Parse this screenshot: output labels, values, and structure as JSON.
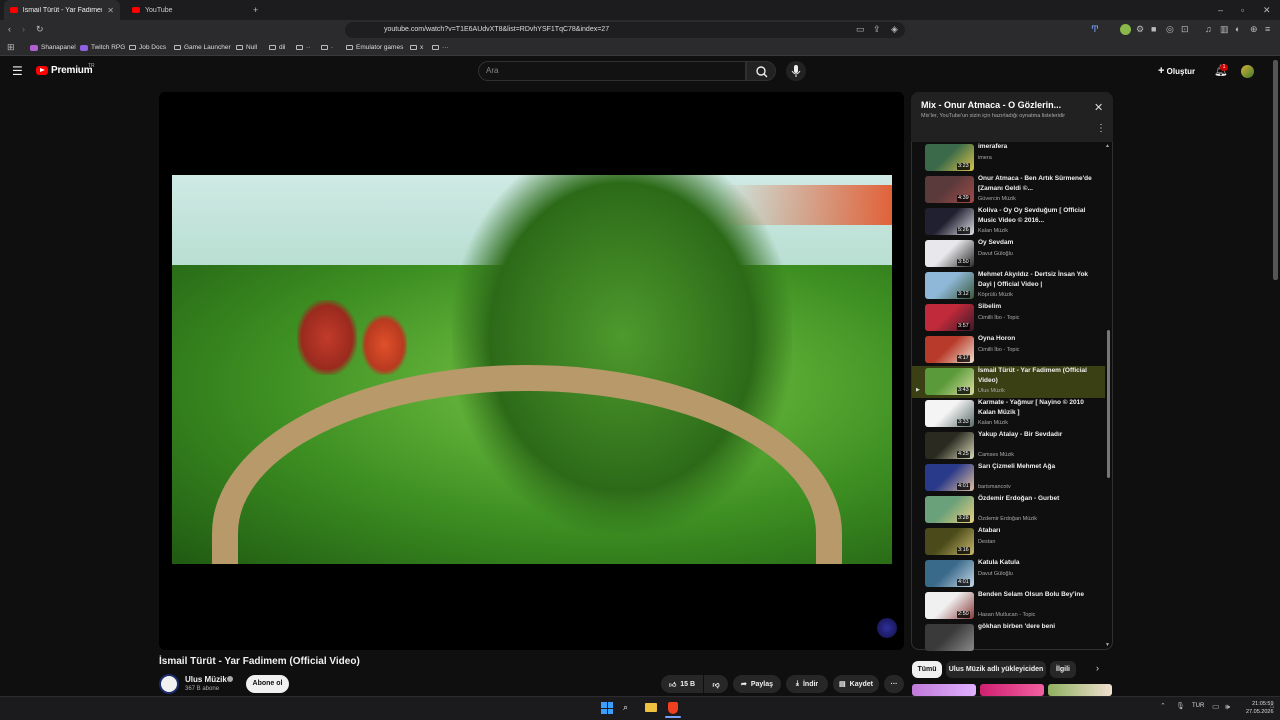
{
  "browser": {
    "tabs": [
      {
        "label": "İsmail Türüt - Yar Fadimem (O"
      },
      {
        "label": "YouTube"
      }
    ],
    "url": "youtube.com/watch?v=T1E6AUdvXT8&list=RDvhYSF1TqC78&index=27",
    "bookmarks": [
      "Shanapanel",
      "Twitch RPG",
      "Job Docs",
      "Game Launcher",
      "Null",
      "dil",
      "Emulator games",
      "x"
    ]
  },
  "youtube": {
    "logo_text": "Premium",
    "logo_region": "TR",
    "search_placeholder": "Ara",
    "create_label": "Oluştur",
    "notif_count": "1"
  },
  "video": {
    "title": "İsmail Türüt - Yar Fadimem (Official Video)",
    "channel": "Ulus Müzik",
    "subscribers": "367 B abone",
    "subscribe_label": "Abone ol",
    "likes": "15 B",
    "share_label": "Paylaş",
    "download_label": "İndir",
    "save_label": "Kaydet"
  },
  "playlist": {
    "title": "Mix - Onur Atmaca - O Gözlerin...",
    "subtitle": "Mix'ler, YouTube'un sizin için hazırladığı oynatma listeleridir",
    "items": [
      {
        "title": "imerafera",
        "channel": "imera",
        "duration": "3:23",
        "c1": "#3a6a4a",
        "c2": "#d9c24a"
      },
      {
        "title": "Onur Atmaca - Ben Artık Sürmene'de [Zamanı Geldi ©...",
        "channel": "Güvercin Müzik",
        "duration": "4:39",
        "c1": "#5a3a3a",
        "c2": "#a04a4a"
      },
      {
        "title": "Koliva - Oy Oy Sevduğum [ Official Music Video © 2016...",
        "channel": "Kalan Müzik",
        "duration": "5:26",
        "c1": "#202030",
        "c2": "#e0e0e8"
      },
      {
        "title": "Oy Sevdam",
        "channel": "Davut Güloğlu",
        "duration": "3:50",
        "c1": "#e8e8ec",
        "c2": "#2a2a2a"
      },
      {
        "title": "Mehmet Akyıldız - Dertsiz İnsan Yok Dayi | Official Video |",
        "channel": "Köprülü Müzik",
        "duration": "3:12",
        "c1": "#8fb8d8",
        "c2": "#3a5a3a"
      },
      {
        "title": "Sibelim",
        "channel": "Cimilli İbo - Topic",
        "duration": "3:57",
        "c1": "#c02a3a",
        "c2": "#3a1a2a"
      },
      {
        "title": "Oyna Horon",
        "channel": "Cimilli İbo - Topic",
        "duration": "4:17",
        "c1": "#b83a2a",
        "c2": "#f0e0d0"
      },
      {
        "title": "İsmail Türüt - Yar Fadimem (Official Video)",
        "channel": "Ulus Müzik",
        "duration": "3:43",
        "c1": "#5a9a3a",
        "c2": "#d8e0a0"
      },
      {
        "title": "Karmate - Yağmur [ Nayino © 2010 Kalan Müzik ]",
        "channel": "Kalan Müzik",
        "duration": "3:33",
        "c1": "#f4f4f4",
        "c2": "#5a6a6a"
      },
      {
        "title": "Yakup Atalay - Bir Sevdadır",
        "channel": "Camses Müzik",
        "duration": "4:25",
        "c1": "#2a2a20",
        "c2": "#d8d8b8"
      },
      {
        "title": "Sarı Çizmeli Mehmet Ağa",
        "channel": "barismancotv",
        "duration": "4:01",
        "c1": "#2a3a8a",
        "c2": "#e0c0a0"
      },
      {
        "title": "Özdemir Erdoğan - Gurbet",
        "channel": "Özdemir Erdoğan Müzik",
        "duration": "3:28",
        "c1": "#6aa07a",
        "c2": "#e8d080"
      },
      {
        "title": "Atabarı",
        "channel": "Destan",
        "duration": "3:16",
        "c1": "#4a4a1a",
        "c2": "#c8b86a"
      },
      {
        "title": "Katula Katula",
        "channel": "Davut Güloğlu",
        "duration": "4:01",
        "c1": "#3a6a8a",
        "c2": "#c8d8e8"
      },
      {
        "title": "Benden Selam Olsun Bolu Bey'ine",
        "channel": "Hasan Mutlucan - Topic",
        "duration": "2:50",
        "c1": "#f0f0f0",
        "c2": "#8a3a3a"
      },
      {
        "title": "gökhan birben 'dere beni",
        "channel": "",
        "duration": "",
        "c1": "#3a3a3a",
        "c2": "#8a8a8a"
      }
    ]
  },
  "chips": [
    {
      "label": "Tümü"
    },
    {
      "label": "Ulus Müzik adlı yükleyiciden"
    },
    {
      "label": "İlgili"
    }
  ],
  "system": {
    "time": "21:05:59",
    "date": "27.05.2026",
    "lang": "TUR"
  }
}
